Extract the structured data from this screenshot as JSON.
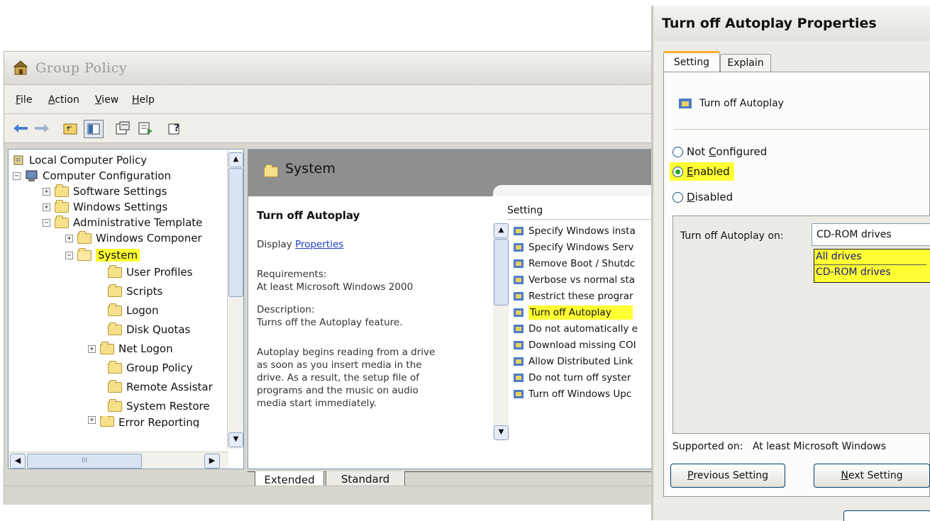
{
  "group_policy": {
    "title": "Group Policy",
    "menu": [
      "File",
      "Action",
      "View",
      "Help"
    ],
    "tree": [
      {
        "label": "Local Computer Policy"
      },
      {
        "label": "Computer Configuration"
      },
      {
        "label": "Software Settings"
      },
      {
        "label": "Windows Settings"
      },
      {
        "label": "Administrative Template"
      },
      {
        "label": "Windows Componer"
      },
      {
        "label": "System"
      },
      {
        "label": "User Profiles"
      },
      {
        "label": "Scripts"
      },
      {
        "label": "Logon"
      },
      {
        "label": "Disk Quotas"
      },
      {
        "label": "Net Logon"
      },
      {
        "label": "Group Policy"
      },
      {
        "label": "Remote Assistar"
      },
      {
        "label": "System Restore"
      },
      {
        "label": "Error Reporting"
      }
    ],
    "scroll_thumb_label": "III",
    "content": {
      "header": "System",
      "title": "Turn off Autoplay",
      "display": "Display",
      "properties_link": "Properties",
      "requirements_label": "Requirements:",
      "requirements_value": "At least Microsoft Windows 2000",
      "description_label": "Description:",
      "description_value": "Turns off the Autoplay feature.",
      "body": [
        "Autoplay begins reading from a drive",
        "as soon as you insert media in the",
        "drive. As a result, the setup file of",
        "programs and the music on audio",
        "media start immediately."
      ],
      "column_header": "Setting",
      "settings": [
        "Specify Windows insta",
        "Specify Windows Serv",
        "Remove Boot / Shutdc",
        "Verbose vs normal sta",
        "Restrict these prograr",
        "Turn off Autoplay",
        "Do not automatically e",
        "Download missing COI",
        "Allow Distributed Link",
        "Do not turn off syster",
        "Turn off Windows Upc"
      ],
      "tabs": [
        "Extended",
        "Standard"
      ]
    }
  },
  "dialog": {
    "title": "Turn off Autoplay Properties",
    "tabs": [
      "Setting",
      "Explain"
    ],
    "policy_name": "Turn off Autoplay",
    "options": [
      "Not Configured",
      "Enabled",
      "Disabled"
    ],
    "selected_option": "Enabled",
    "turn_off_on_label": "Turn off Autoplay on:",
    "turn_off_on_value": "CD-ROM drives",
    "dropdown_options": [
      "All drives",
      "CD-ROM drives"
    ],
    "supported_on_label": "Supported on:",
    "supported_on_value": "At least Microsoft Windows",
    "buttons": {
      "previous": "Previous Setting",
      "next": "Next Setting"
    }
  },
  "colors": {
    "highlight": "#ffff33",
    "link": "#1a3fc4",
    "header_gray": "#8f8f8f"
  }
}
